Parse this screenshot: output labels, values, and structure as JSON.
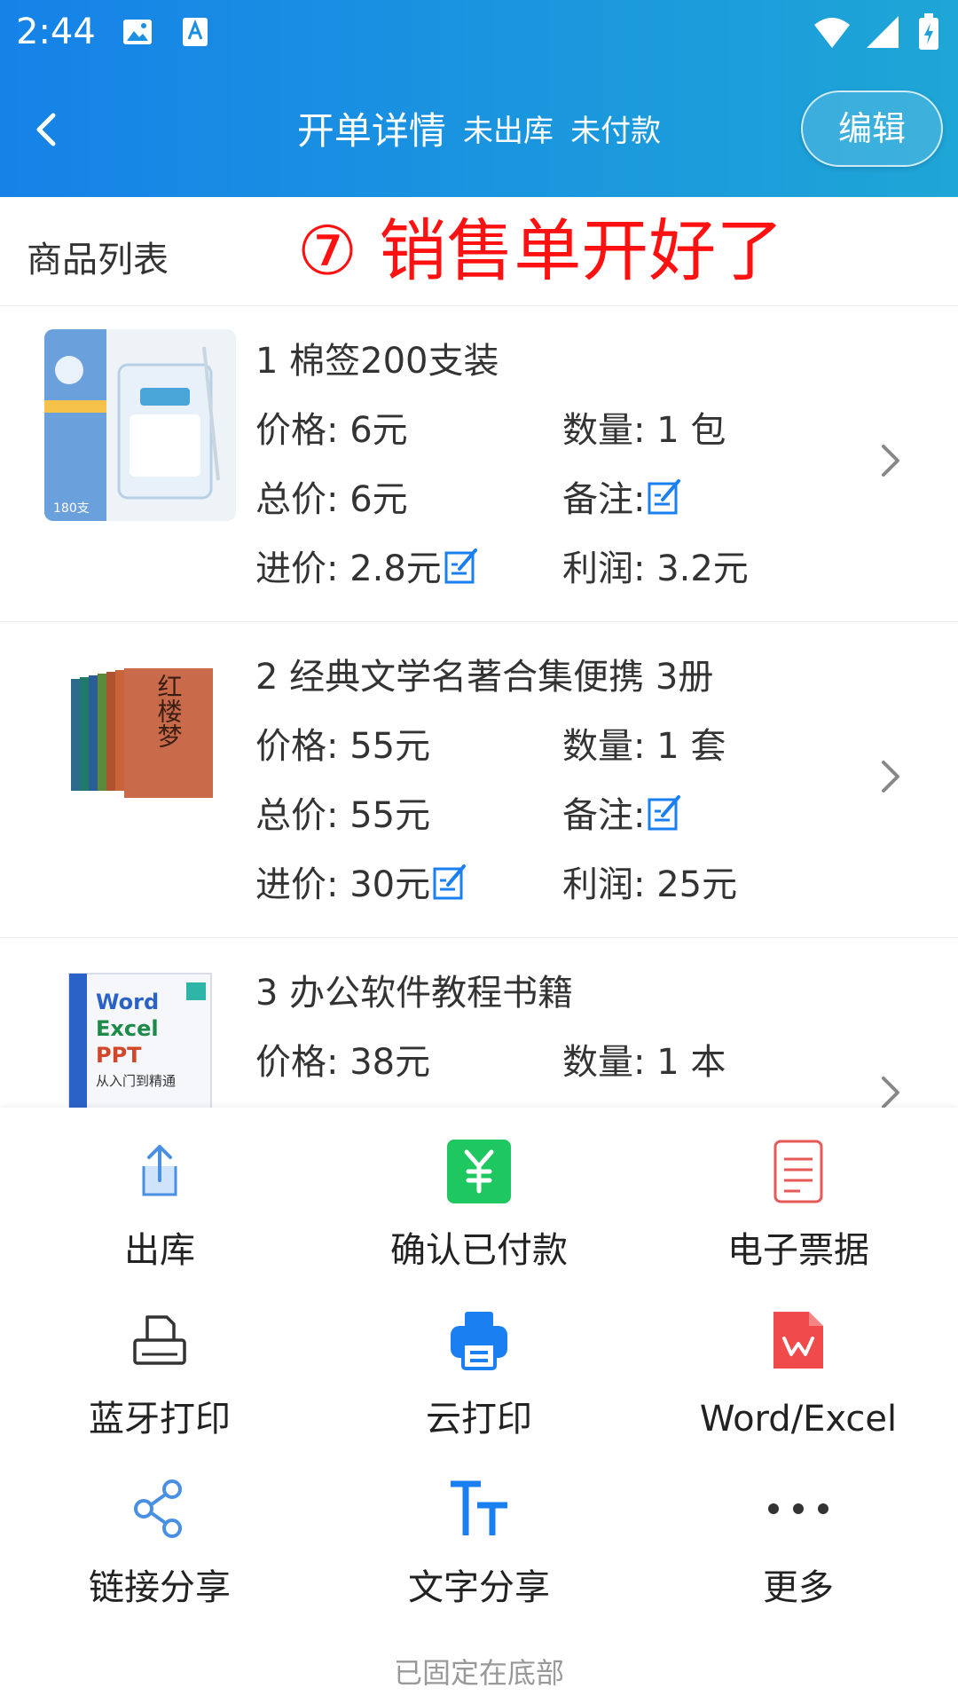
{
  "status_bar": {
    "time": "2:44",
    "icons": [
      "gallery-icon",
      "text-a-icon",
      "wifi-icon",
      "signal-icon",
      "battery-charging-icon"
    ]
  },
  "nav": {
    "back_icon": "back-arrow-icon",
    "title": "开单详情",
    "status_shipping": "未出库",
    "status_payment": "未付款",
    "edit_label": "编辑"
  },
  "section": {
    "title": "商品列表",
    "note": "⑦ 销售单开好了"
  },
  "products": [
    {
      "name": "1 棉签200支装",
      "price": "价格: 6元",
      "quantity": "数量: 1 包",
      "total": "总价: 6元",
      "remark": "备注:",
      "cost": "进价: 2.8元",
      "profit": "利润: 3.2元"
    },
    {
      "name": "2 经典文学名著合集便携 3册",
      "price": "价格: 55元",
      "quantity": "数量: 1 套",
      "total": "总价: 55元",
      "remark": "备注:",
      "cost": "进价: 30元",
      "profit": "利润: 25元"
    },
    {
      "name": "3 办公软件教程书籍",
      "price": "价格: 38元",
      "quantity": "数量: 1 本",
      "thumb_text": {
        "word": "Word",
        "excel": "Excel",
        "ppt": "PPT",
        "side": "从入门到精通"
      }
    }
  ],
  "product_images": {
    "p1_box_text": "180支",
    "p2_cover_text": "红楼梦"
  },
  "actions": [
    {
      "label": "出库",
      "icon": "upload-icon"
    },
    {
      "label": "确认已付款",
      "icon": "yuan-payment-icon"
    },
    {
      "label": "电子票据",
      "icon": "document-icon"
    },
    {
      "label": "蓝牙打印",
      "icon": "bluetooth-printer-icon"
    },
    {
      "label": "云打印",
      "icon": "cloud-printer-icon"
    },
    {
      "label": "Word/Excel",
      "icon": "wps-file-icon"
    },
    {
      "label": "链接分享",
      "icon": "share-icon"
    },
    {
      "label": "文字分享",
      "icon": "text-size-icon"
    },
    {
      "label": "更多",
      "icon": "more-dots-icon"
    }
  ],
  "footer": {
    "pinned_text": "已固定在底部"
  },
  "colors": {
    "header_gradient_start": "#1682e8",
    "header_gradient_end": "#1ea6d6",
    "note_red": "#ff1111",
    "accent_blue": "#1a7ff0",
    "pay_green": "#1ec760",
    "doc_red": "#e85a5a",
    "wps_red": "#f04a4a"
  }
}
